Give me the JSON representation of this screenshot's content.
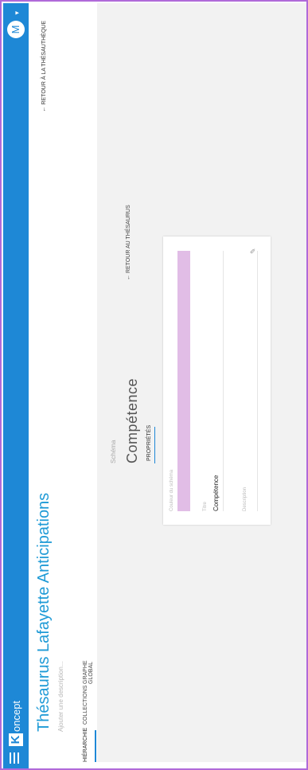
{
  "app": {
    "logo_letter": "K",
    "logo_text": "oncept",
    "avatar_initial": "M"
  },
  "thesaurus": {
    "title": "Thésaurus Lafayette Anticipations",
    "description_placeholder": "Ajouter une description...",
    "back_label": "RETOUR À LA THÉSAUTHÈQUE"
  },
  "tabs": [
    "HIÉRARCHIE",
    "COLLECTIONS",
    "GRAPHE GLOBAL"
  ],
  "concept": {
    "schema_label": "Schéma",
    "title": "Compétence",
    "properties_tab": "PROPRIÉTÉS",
    "back_label": "RETOUR AU THÉSAURUS"
  },
  "form": {
    "color_label": "Couleur du schéma",
    "color_value": "#e1bde6",
    "title_label": "Titre",
    "title_value": "Compétence",
    "description_label": "Description"
  },
  "icons": {
    "menu": "menu-icon",
    "back": "arrow-left-icon",
    "edit": "pencil-icon"
  },
  "colors": {
    "primary": "#1e88d6",
    "title": "#1e9ad6"
  }
}
